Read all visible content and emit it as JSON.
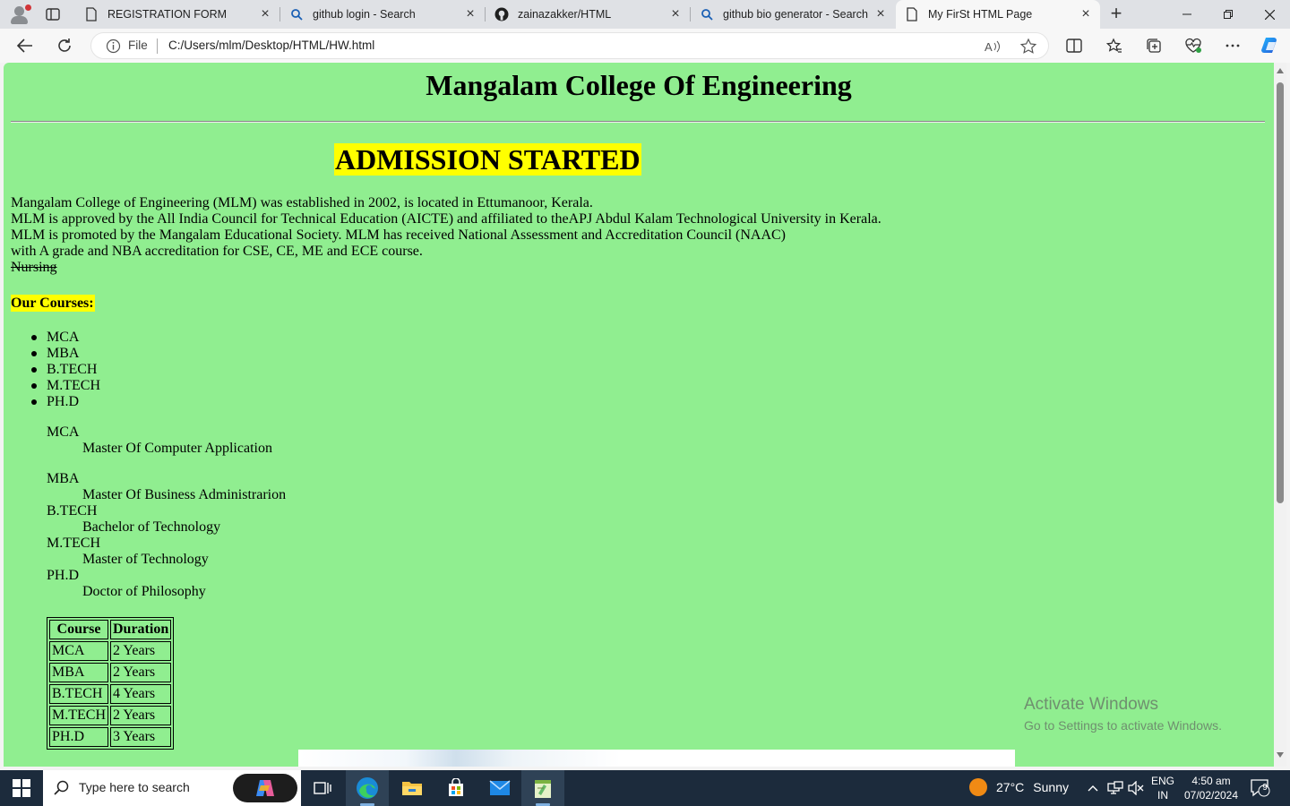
{
  "browser": {
    "tabs": [
      {
        "title": "REGISTRATION FORM",
        "icon": "page-icon",
        "active": false
      },
      {
        "title": "github login - Search",
        "icon": "search-icon",
        "active": false
      },
      {
        "title": "zainazakker/HTML",
        "icon": "github-icon",
        "active": false
      },
      {
        "title": "github bio generator - Search",
        "icon": "search-icon",
        "active": false
      },
      {
        "title": "My FirSt HTML Page",
        "icon": "page-icon",
        "active": true
      }
    ],
    "address": {
      "scheme_label": "File",
      "url": "C:/Users/mlm/Desktop/HTML/HW.html"
    }
  },
  "page": {
    "background": "#90ee90",
    "highlight": "#ffff00",
    "title": "Mangalam College Of Engineering",
    "banner": "ADMISSION STARTED",
    "intro_lines": [
      "Mangalam College of Engineering (MLM) was established in 2002, is located in Ettumanoor, Kerala.",
      "MLM is approved by the All India Council for Technical Education (AICTE) and affiliated to theAPJ Abdul Kalam Technological University in Kerala.",
      "MLM is promoted by the Mangalam Educational Society. MLM has received National Assessment and Accreditation Council (NAAC)",
      "with A grade and NBA accreditation for CSE, CE, ME and ECE course."
    ],
    "struck_text": "Nursing",
    "courses_heading": "Our Courses:",
    "courses": [
      "MCA",
      "MBA",
      "B.TECH",
      "M.TECH",
      "PH.D"
    ],
    "definitions": [
      {
        "term": "MCA",
        "desc": "Master Of Computer Application"
      },
      {
        "term": "MBA",
        "desc": "Master Of Business Administrarion"
      },
      {
        "term": "B.TECH",
        "desc": "Bachelor of Technology"
      },
      {
        "term": "M.TECH",
        "desc": "Master of Technology"
      },
      {
        "term": "PH.D",
        "desc": "Doctor of Philosophy"
      }
    ],
    "table": {
      "headers": [
        "Course",
        "Duration"
      ],
      "rows": [
        [
          "MCA",
          "2 Years"
        ],
        [
          "MBA",
          "2 Years"
        ],
        [
          "B.TECH",
          "4 Years"
        ],
        [
          "M.TECH",
          "2 Years"
        ],
        [
          "PH.D",
          "3 Years"
        ]
      ]
    },
    "watermark": {
      "line1": "Activate Windows",
      "line2": "Go to Settings to activate Windows."
    }
  },
  "taskbar": {
    "search_placeholder": "Type here to search",
    "apps": [
      "task-view-icon",
      "edge-icon",
      "file-explorer-icon",
      "store-icon",
      "mail-icon",
      "notepad-plus-icon"
    ],
    "weather": {
      "temp": "27°C",
      "condition": "Sunny"
    },
    "language": {
      "line1": "ENG",
      "line2": "IN"
    },
    "clock": {
      "time": "4:50 am",
      "date": "07/02/2024"
    },
    "notifications": "9"
  }
}
